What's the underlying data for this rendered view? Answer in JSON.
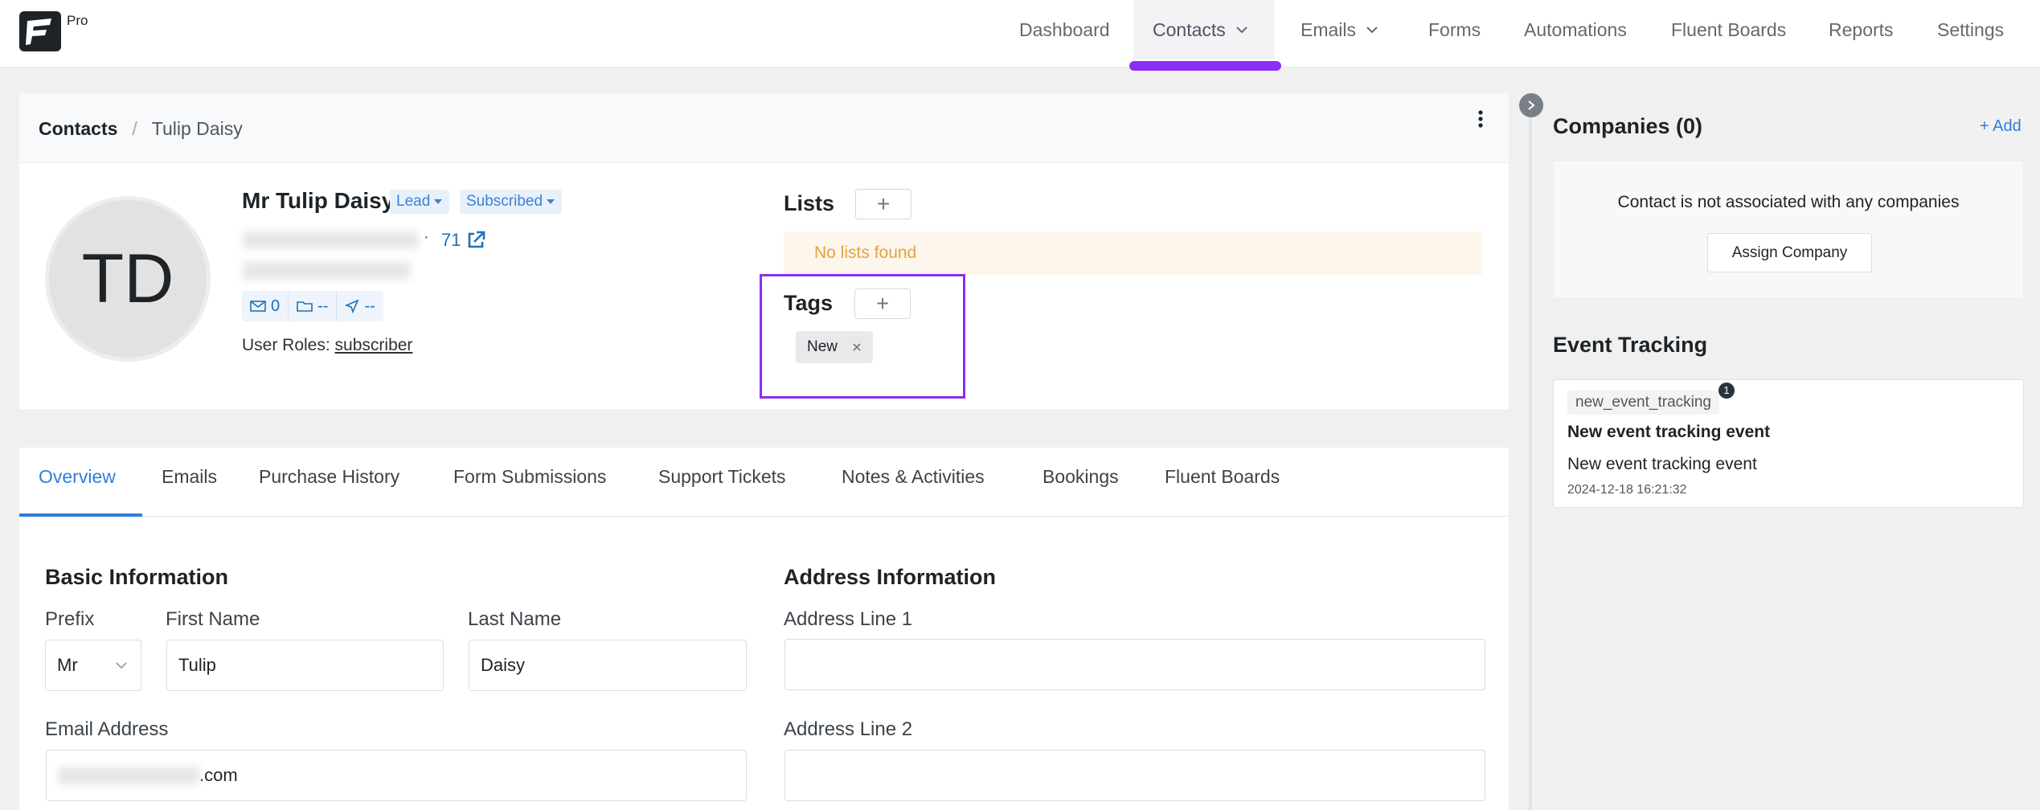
{
  "header": {
    "logo_badge": "Pro",
    "nav": [
      {
        "label": "Dashboard"
      },
      {
        "label": "Contacts"
      },
      {
        "label": "Emails"
      },
      {
        "label": "Forms"
      },
      {
        "label": "Automations"
      },
      {
        "label": "Fluent Boards"
      },
      {
        "label": "Reports"
      },
      {
        "label": "Settings"
      }
    ],
    "active_nav": "Contacts",
    "accent_color": "#8b2ef2"
  },
  "breadcrumb": {
    "root": "Contacts",
    "separator": "/",
    "current": "Tulip Daisy"
  },
  "contact": {
    "initials": "TD",
    "full_name": "Mr Tulip Daisy",
    "status_chip": "Lead",
    "subscription_chip": "Subscribed",
    "bullet": "·",
    "id_number": "71",
    "email_count": "0",
    "list_count": "--",
    "campaign_count": "--",
    "roles_label": "User Roles:",
    "roles_value": "subscriber"
  },
  "lists": {
    "title": "Lists",
    "empty_text": "No lists found"
  },
  "tags": {
    "title": "Tags",
    "items": [
      {
        "label": "New"
      }
    ],
    "highlight_color": "#8b2ef2"
  },
  "tabs": [
    {
      "label": "Overview"
    },
    {
      "label": "Emails"
    },
    {
      "label": "Purchase History"
    },
    {
      "label": "Form Submissions"
    },
    {
      "label": "Support Tickets"
    },
    {
      "label": "Notes & Activities"
    },
    {
      "label": "Bookings"
    },
    {
      "label": "Fluent Boards"
    }
  ],
  "active_tab": "Overview",
  "basic_info": {
    "title": "Basic Information",
    "prefix_label": "Prefix",
    "prefix_value": "Mr",
    "first_name_label": "First Name",
    "first_name_value": "Tulip",
    "last_name_label": "Last Name",
    "last_name_value": "Daisy",
    "email_label": "Email Address",
    "email_suffix": ".com"
  },
  "address_info": {
    "title": "Address Information",
    "line1_label": "Address Line 1",
    "line1_value": "",
    "line2_label": "Address Line 2",
    "line2_value": ""
  },
  "sidebar": {
    "companies_title": "Companies (0)",
    "add_link": "+ Add",
    "no_companies_text": "Contact is not associated with any companies",
    "assign_button": "Assign Company",
    "event_title": "Event Tracking",
    "event": {
      "key": "new_event_tracking",
      "count": "1",
      "name": "New event tracking event",
      "description": "New event tracking event",
      "timestamp": "2024-12-18 16:21:32"
    }
  }
}
